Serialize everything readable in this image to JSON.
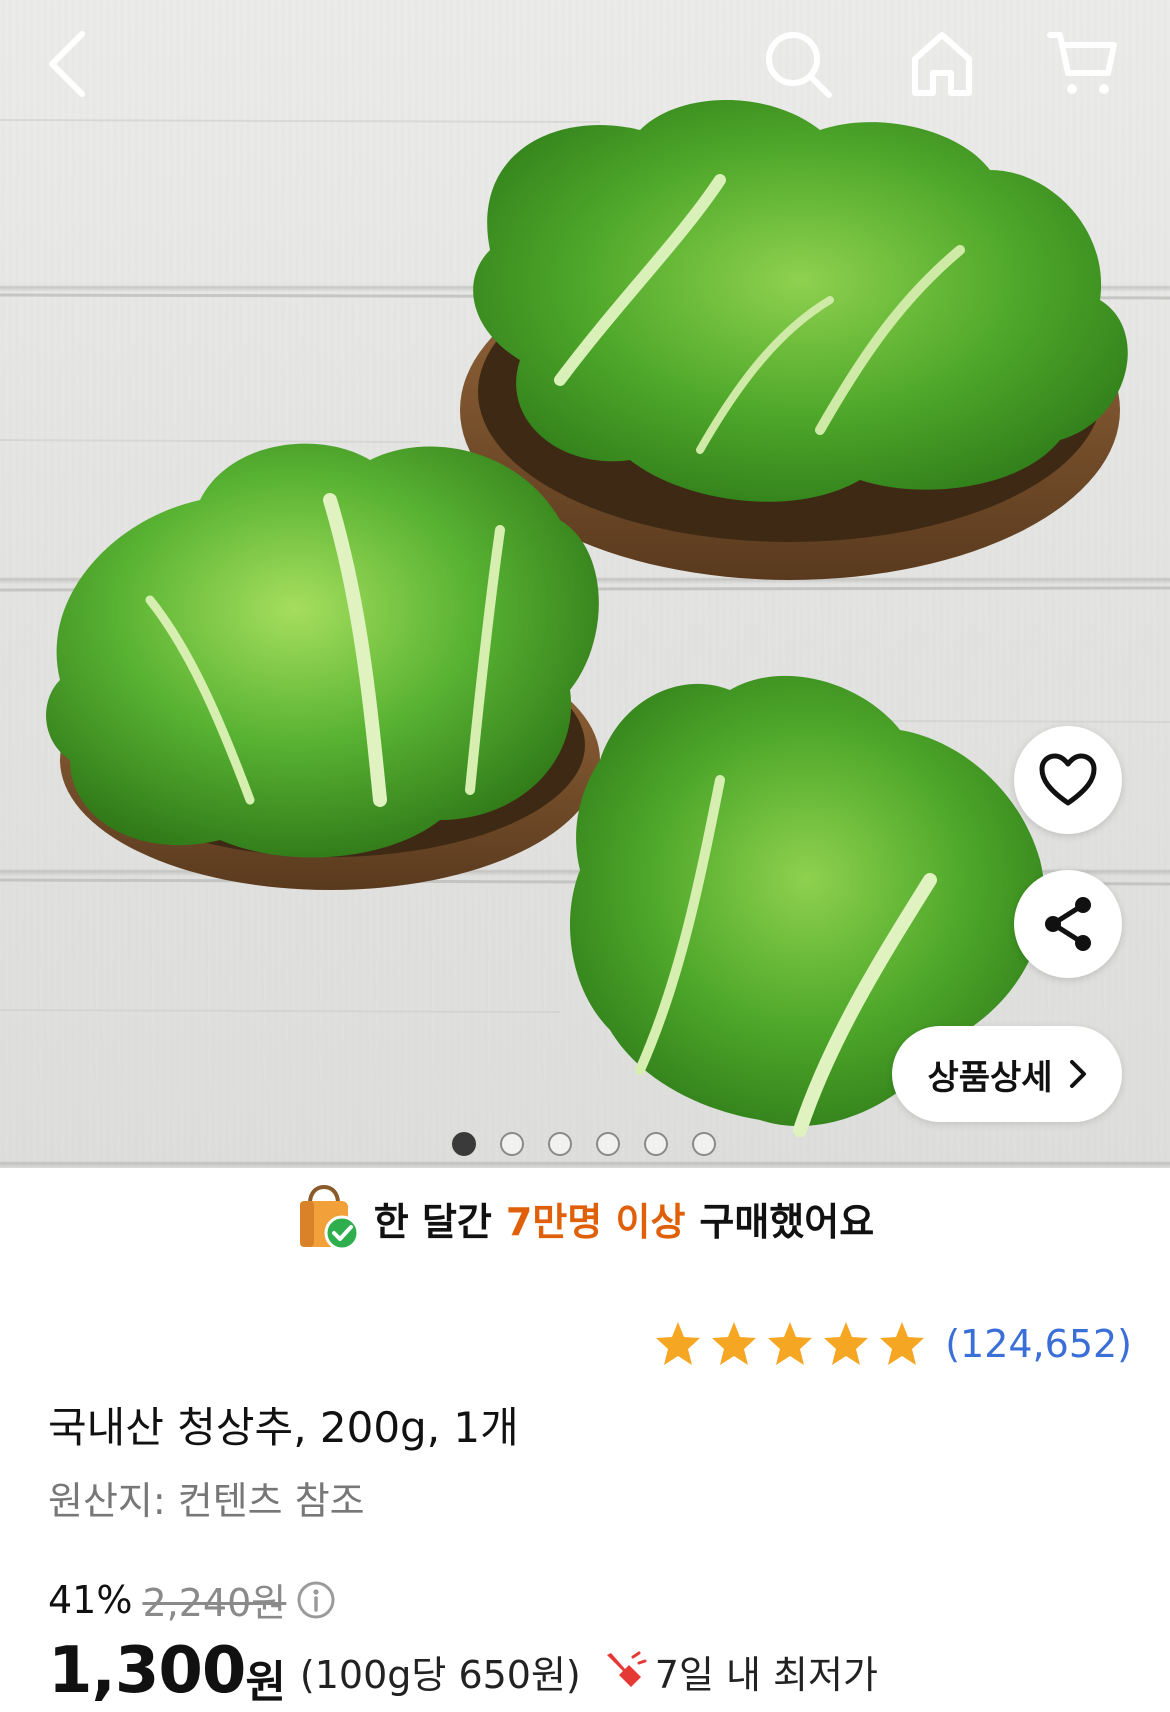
{
  "nav": {
    "back_icon": "chevron-left-icon",
    "search_icon": "search-icon",
    "home_icon": "home-icon",
    "cart_icon": "cart-icon"
  },
  "gallery": {
    "image_subject": "lettuce-photo",
    "dots_total": 6,
    "active_dot": 1,
    "wishlist_icon": "heart-icon",
    "share_icon": "share-icon",
    "detail_button_label": "상품상세"
  },
  "banner": {
    "prefix": "한 달간",
    "highlight": "7만명 이상",
    "suffix": "구매했어요",
    "highlight_color": "#e0600a"
  },
  "rating": {
    "stars": 5,
    "count": "(124,652)",
    "star_color": "#f5a623",
    "count_color": "#3a6fd8"
  },
  "product": {
    "title": "국내산 청상추, 200g, 1개",
    "origin": "원산지: 컨텐츠 참조"
  },
  "pricing": {
    "discount_rate": "41%",
    "original_price": "2,240원",
    "price": "1,300",
    "currency": "원",
    "unit_price": "(100g당 650원)",
    "lowest_label": "7일 내 최저가"
  }
}
